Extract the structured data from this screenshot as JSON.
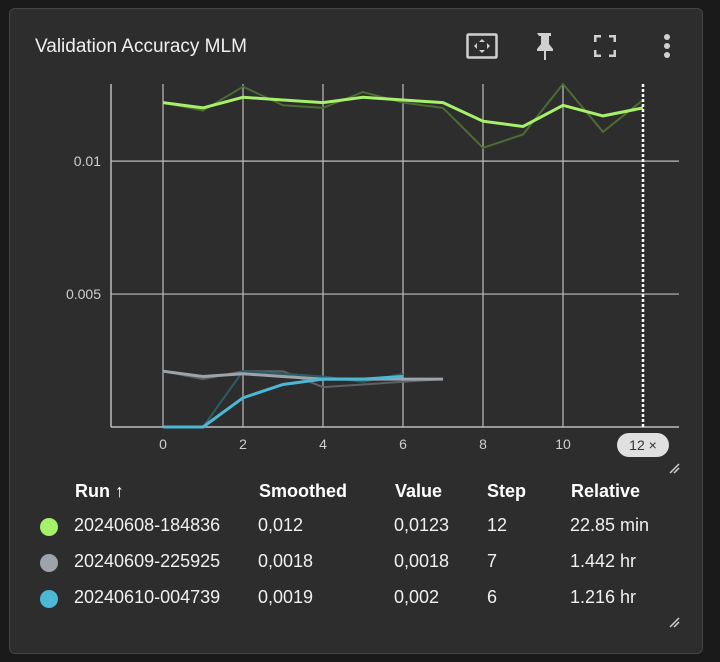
{
  "card": {
    "title": "Validation Accuracy MLM",
    "toolbar": {
      "fit_icon": "fit-domain-icon",
      "pin_icon": "pin-icon",
      "fullscreen_icon": "fullscreen-icon",
      "more_icon": "more-vert-icon"
    }
  },
  "chart_data": {
    "type": "line",
    "title": "Validation Accuracy MLM",
    "xlabel": "",
    "ylabel": "",
    "xlim": [
      -1.3,
      12.9
    ],
    "ylim": [
      0.0,
      0.0129
    ],
    "x_ticks": [
      "0",
      "2",
      "4",
      "6",
      "8",
      "10"
    ],
    "y_ticks": [
      "0.005",
      "0.01"
    ],
    "y_tick_values": [
      0.005,
      0.01
    ],
    "grid": true,
    "step_marker": {
      "step": 12,
      "label": "12 ×"
    },
    "series": [
      {
        "name": "20240608-184836",
        "color": "#a6f06a",
        "raw_color": "#4d6b35",
        "x": [
          0,
          1,
          2,
          3,
          4,
          5,
          6,
          7,
          8,
          9,
          10,
          11,
          12
        ],
        "raw": [
          0.0122,
          0.0119,
          0.0128,
          0.0121,
          0.012,
          0.0126,
          0.0122,
          0.012,
          0.0105,
          0.011,
          0.0135,
          0.0111,
          0.0123
        ],
        "smoothed": [
          0.0122,
          0.012,
          0.0124,
          0.0123,
          0.0122,
          0.0124,
          0.0123,
          0.0122,
          0.0115,
          0.0113,
          0.0121,
          0.0117,
          0.012
        ]
      },
      {
        "name": "20240609-225925",
        "color": "#9ca3ab",
        "raw_color": "#5d6166",
        "x": [
          0,
          1,
          2,
          3,
          4,
          5,
          6,
          7
        ],
        "raw": [
          0.0021,
          0.0018,
          0.0021,
          0.0021,
          0.0015,
          0.0016,
          0.0017,
          0.0018
        ],
        "smoothed": [
          0.0021,
          0.0019,
          0.002,
          0.0019,
          0.0018,
          0.0018,
          0.0018,
          0.0018
        ]
      },
      {
        "name": "20240610-004739",
        "color": "#4db8d4",
        "raw_color": "#2a5d6a",
        "x": [
          0,
          1,
          2,
          3,
          4,
          5,
          6
        ],
        "raw": [
          0.0,
          0.0,
          0.0021,
          0.002,
          0.0019,
          0.0017,
          0.002
        ],
        "smoothed": [
          0.0,
          0.0,
          0.0011,
          0.0016,
          0.0018,
          0.0018,
          0.0019
        ]
      }
    ]
  },
  "table": {
    "headers": {
      "run": "Run ↑",
      "smoothed": "Smoothed",
      "value": "Value",
      "step": "Step",
      "relative": "Relative"
    },
    "rows": [
      {
        "run": "20240608-184836",
        "smoothed": "0,012",
        "value": "0,0123",
        "step": "12",
        "relative": "22.85 min",
        "color": "#a6f06a"
      },
      {
        "run": "20240609-225925",
        "smoothed": "0,0018",
        "value": "0,0018",
        "step": "7",
        "relative": "1.442 hr",
        "color": "#9ca3ab"
      },
      {
        "run": "20240610-004739",
        "smoothed": "0,0019",
        "value": "0,002",
        "step": "6",
        "relative": "1.216 hr",
        "color": "#4db8d4"
      }
    ]
  }
}
